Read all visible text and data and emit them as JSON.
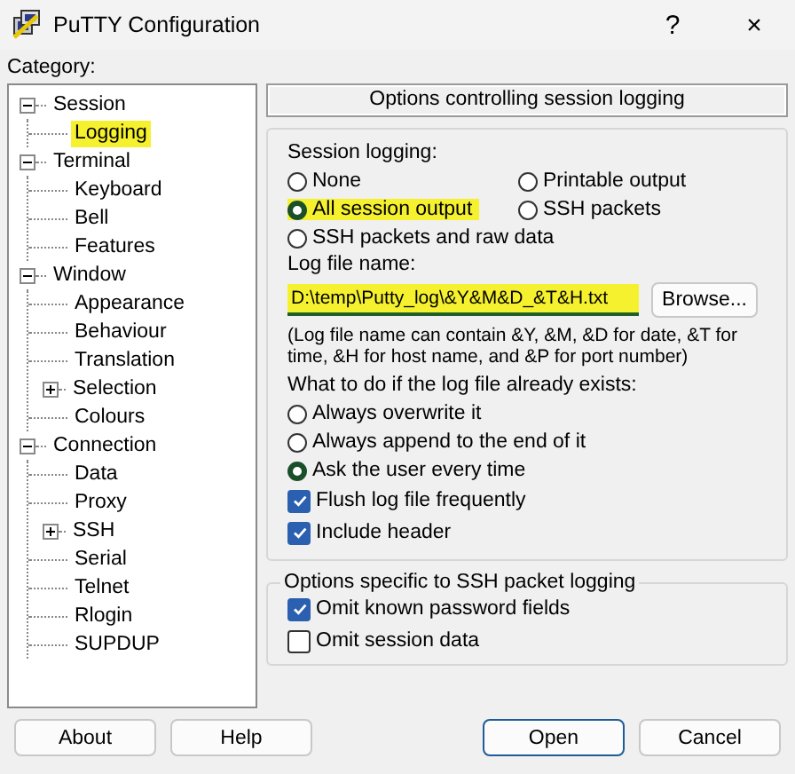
{
  "window": {
    "title": "PuTTY Configuration",
    "help": "?",
    "close": "×"
  },
  "category_label": "Category:",
  "tree": [
    {
      "label": "Session",
      "selected": false,
      "expanded": true,
      "children": [
        {
          "label": "Logging",
          "selected": true
        }
      ]
    },
    {
      "label": "Terminal",
      "selected": false,
      "expanded": true,
      "children": [
        {
          "label": "Keyboard",
          "selected": false
        },
        {
          "label": "Bell",
          "selected": false
        },
        {
          "label": "Features",
          "selected": false
        }
      ]
    },
    {
      "label": "Window",
      "selected": false,
      "expanded": true,
      "children": [
        {
          "label": "Appearance",
          "selected": false
        },
        {
          "label": "Behaviour",
          "selected": false
        },
        {
          "label": "Translation",
          "selected": false
        },
        {
          "label": "Selection",
          "selected": false,
          "expanded": false
        },
        {
          "label": "Colours",
          "selected": false
        }
      ]
    },
    {
      "label": "Connection",
      "selected": false,
      "expanded": true,
      "children": [
        {
          "label": "Data",
          "selected": false
        },
        {
          "label": "Proxy",
          "selected": false
        },
        {
          "label": "SSH",
          "selected": false,
          "expanded": false
        },
        {
          "label": "Serial",
          "selected": false
        },
        {
          "label": "Telnet",
          "selected": false
        },
        {
          "label": "Rlogin",
          "selected": false
        },
        {
          "label": "SUPDUP",
          "selected": false
        }
      ]
    }
  ],
  "panel": {
    "header": "Options controlling session logging",
    "session_logging": {
      "label": "Session logging:",
      "options": [
        {
          "label": "None",
          "selected": false,
          "highlighted": false
        },
        {
          "label": "Printable output",
          "selected": false,
          "highlighted": false
        },
        {
          "label": "All session output",
          "selected": true,
          "highlighted": true
        },
        {
          "label": "SSH packets",
          "selected": false,
          "highlighted": false
        },
        {
          "label": "SSH packets and raw data",
          "selected": false,
          "highlighted": false
        }
      ]
    },
    "log_file": {
      "label": "Log file name:",
      "value": "D:\\temp\\Putty_log\\&Y&M&D_&T&H.txt",
      "highlighted": true,
      "browse": "Browse..."
    },
    "hint": "(Log file name can contain &Y, &M, &D for date, &T for time, &H for host name, and &P for port number)",
    "exists": {
      "label": "What to do if the log file already exists:",
      "options": [
        {
          "label": "Always overwrite it",
          "selected": false
        },
        {
          "label": "Always append to the end of it",
          "selected": false
        },
        {
          "label": "Ask the user every time",
          "selected": true
        }
      ]
    },
    "checks": [
      {
        "label": "Flush log file frequently",
        "checked": true
      },
      {
        "label": "Include header",
        "checked": true
      }
    ],
    "ssh": {
      "title": "Options specific to SSH packet logging",
      "checks": [
        {
          "label": "Omit known password fields",
          "checked": true
        },
        {
          "label": "Omit session data",
          "checked": false
        }
      ]
    }
  },
  "left_buttons": [
    {
      "label": "About",
      "default": false
    },
    {
      "label": "Help",
      "default": false
    }
  ],
  "right_buttons": [
    {
      "label": "Open",
      "default": true
    },
    {
      "label": "Cancel",
      "default": false
    }
  ]
}
